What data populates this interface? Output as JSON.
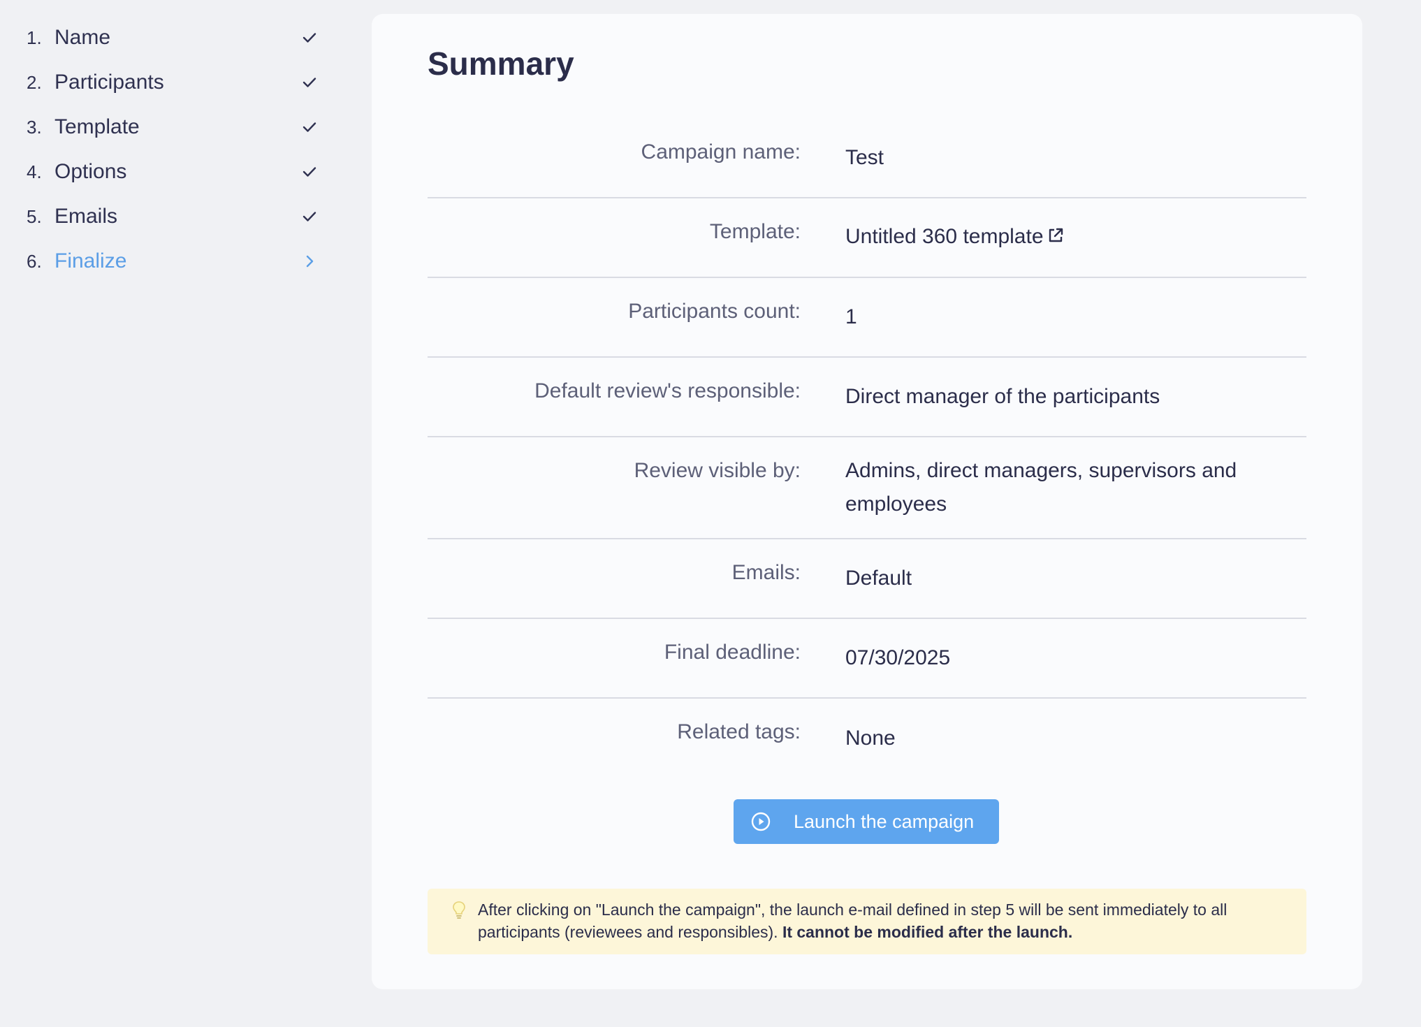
{
  "sidebar": {
    "steps": [
      {
        "number": "1.",
        "label": "Name",
        "status": "done",
        "icon": "check-icon"
      },
      {
        "number": "2.",
        "label": "Participants",
        "status": "done",
        "icon": "check-icon"
      },
      {
        "number": "3.",
        "label": "Template",
        "status": "done",
        "icon": "check-icon"
      },
      {
        "number": "4.",
        "label": "Options",
        "status": "done",
        "icon": "check-icon"
      },
      {
        "number": "5.",
        "label": "Emails",
        "status": "done",
        "icon": "check-icon"
      },
      {
        "number": "6.",
        "label": "Finalize",
        "status": "active",
        "icon": "chevron-right-icon"
      }
    ]
  },
  "summary": {
    "title": "Summary",
    "rows": [
      {
        "label": "Campaign name:",
        "value": "Test"
      },
      {
        "label": "Template:",
        "value": "Untitled 360 template",
        "link": true
      },
      {
        "label": "Participants count:",
        "value": "1"
      },
      {
        "label": "Default review's responsible:",
        "value": "Direct manager of the participants"
      },
      {
        "label": "Review visible by:",
        "value": "Admins, direct managers, supervisors and employees"
      },
      {
        "label": "Emails:",
        "value": "Default"
      },
      {
        "label": "Final deadline:",
        "value": "07/30/2025"
      },
      {
        "label": "Related tags:",
        "value": "None"
      }
    ],
    "launch_label": "Launch the campaign",
    "notice": {
      "text": "After clicking on \"Launch the campaign\", the launch e-mail defined in step 5 will be sent immediately to all participants (reviewees and responsibles). ",
      "bold": "It cannot be modified after the launch."
    }
  },
  "colors": {
    "accent": "#5ea5ee",
    "active_step": "#5b9ee6",
    "notice_bg": "#fdf6d9",
    "page_bg": "#f0f1f4"
  }
}
